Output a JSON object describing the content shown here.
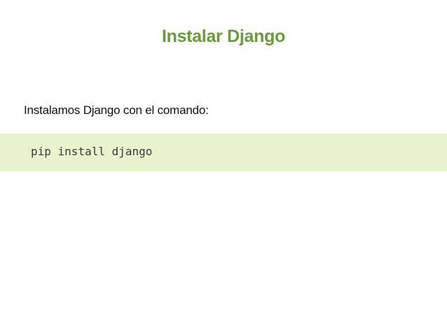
{
  "slide": {
    "title": "Instalar Django",
    "intro_text": "Instalamos Django con el comando:",
    "code": "pip install django"
  },
  "colors": {
    "title": "#6a9a3c",
    "code_background": "#e8f2cc",
    "body_text": "#111111"
  }
}
